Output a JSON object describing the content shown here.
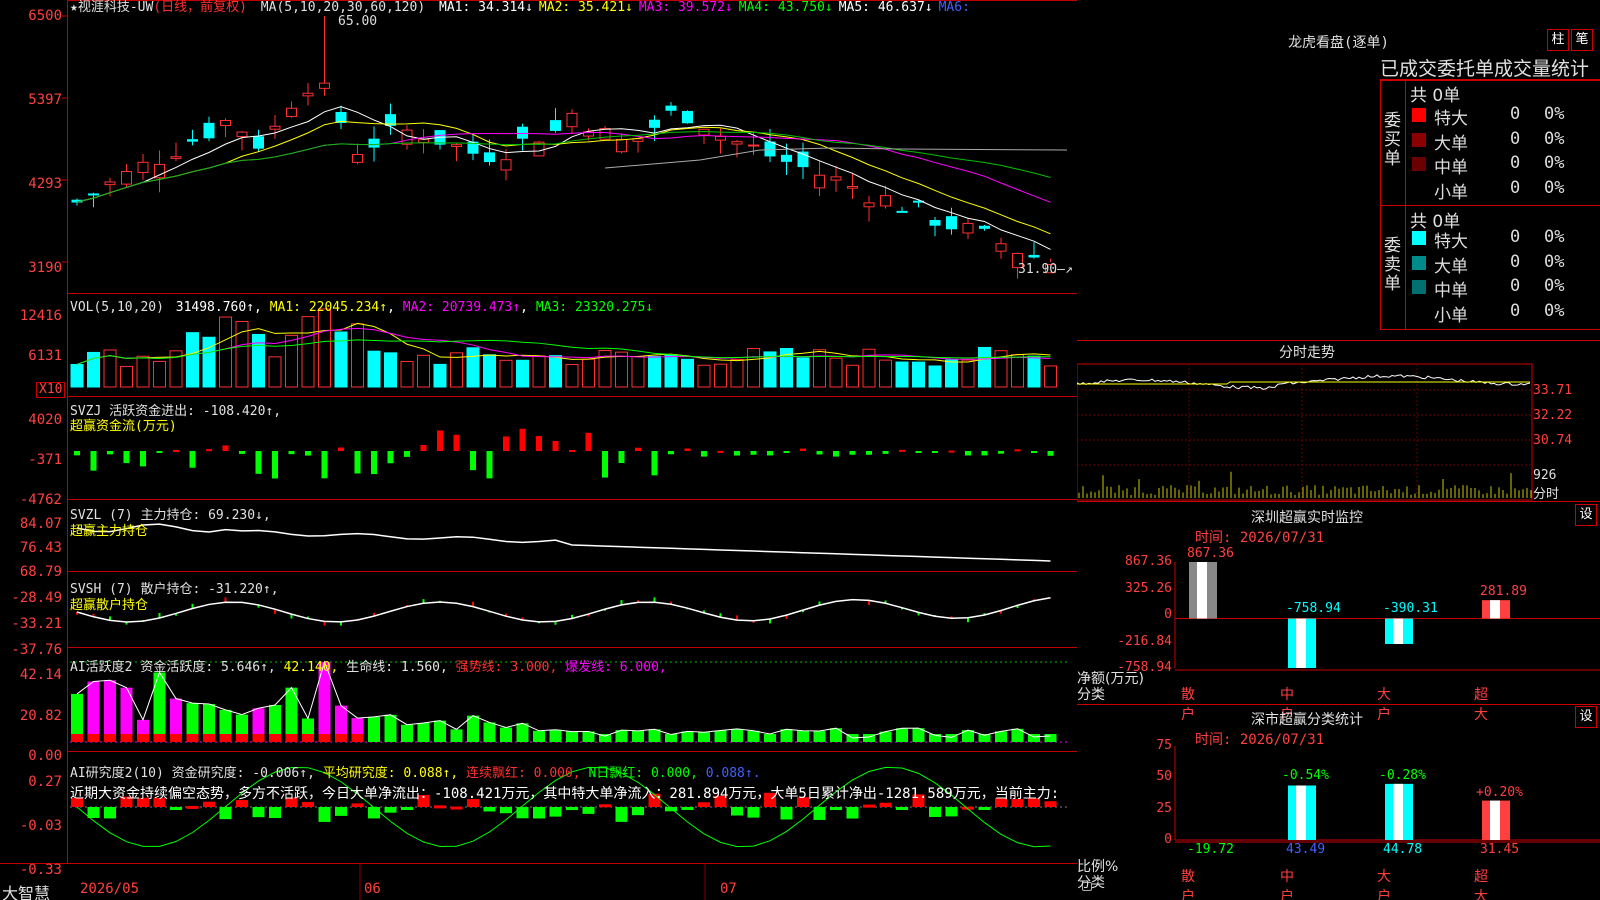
{
  "chart_title": {
    "stock_name": "★视涯科技-UW",
    "period_tag": "(日线，前复权)",
    "ma_spec": "MA(5,10,20,30,60,120)",
    "ma_values": [
      {
        "label": "MA1:",
        "value": "34.314↓",
        "color": "#ffffff"
      },
      {
        "label": "MA2:",
        "value": "35.421↓",
        "color": "#ffff00"
      },
      {
        "label": "MA3:",
        "value": "39.572↓",
        "color": "#ff00ff"
      },
      {
        "label": "MA4:",
        "value": "43.750↓",
        "color": "#00ff00"
      },
      {
        "label": "MA5:",
        "value": "46.637↓",
        "color": "#ffffff"
      },
      {
        "label": "MA6:",
        "value": "",
        "color": "#4060ff"
      }
    ],
    "high_label": "65.00",
    "low_label": "31.90"
  },
  "main_y_labels": [
    "6500",
    "5397",
    "4293",
    "3190"
  ],
  "vol": {
    "header": "VOL(5,10,20)",
    "value": "31498.760↑",
    "ma1": "MA1: 22045.234↑",
    "ma2": "MA2: 20739.473↑",
    "ma3": "MA3: 23320.275↓",
    "y_labels": [
      "12416",
      "6131"
    ],
    "unit_tag": "X10"
  },
  "svzj": {
    "header": "SVZJ  活跃资金进出: -108.420↑,",
    "sub": "超赢资金流(万元)",
    "y_labels": [
      "4020",
      "-371",
      "-4762"
    ]
  },
  "svzl": {
    "header": "SVZL (7) 主力持仓: 69.230↓,",
    "sub": "超赢主力持仓",
    "y_labels": [
      "84.07",
      "76.43",
      "68.79"
    ]
  },
  "svsh": {
    "header": "SVSH (7) 散户持仓: -31.220↑,",
    "sub": "超赢散户持仓",
    "y_labels": [
      "-28.49",
      "-33.21",
      "-37.76"
    ]
  },
  "ai_active": {
    "title": "AI活跃度2",
    "part1": "资金活跃度: 5.646↑,",
    "part2": "42.140,",
    "part3": "生命线: 1.560,",
    "part4": "强势线: 3.000,",
    "part5": "爆发线: 6.000,",
    "y_labels": [
      "42.14",
      "20.82",
      "0.00"
    ]
  },
  "ai_research": {
    "title": "AI研究度2(10)",
    "part1": "资金研究度: -0.006↑,",
    "part2": "平均研究度: 0.088↑,",
    "part3": "连续飘红: 0.000,",
    "part4": "N日飘红: 0.000,",
    "part5": "0.088↑.",
    "commentary": "近期大资金持续偏空态势，多方不活跃，今日大单净流出：-108.421万元，其中特大单净流入：281.894万元，大单5日累计净出-1281.589万元，当前主力:",
    "y_labels": [
      "0.27",
      "-0.03",
      "-0.33"
    ]
  },
  "x_axis": {
    "brand": "大智慧",
    "labels": [
      "2026/05",
      "06",
      "07"
    ]
  },
  "longhu": {
    "title": "龙虎看盘(逐单)",
    "btn_col": "柱",
    "btn_bi": "笔",
    "tabs": [
      "已成交",
      "委托单",
      "成交量统计"
    ],
    "buy_total": "共 0单",
    "sell_total": "共 0单",
    "buy_side_label": "委买单",
    "sell_side_label": "委卖单",
    "buy_rows": [
      {
        "name": "特大",
        "count": "0",
        "pct": "0%",
        "color": "#ff0000"
      },
      {
        "name": "大单",
        "count": "0",
        "pct": "0%",
        "color": "#8b0000"
      },
      {
        "name": "中单",
        "count": "0",
        "pct": "0%",
        "color": "#6b0000"
      },
      {
        "name": "小单",
        "count": "0",
        "pct": "0%",
        "color": ""
      }
    ],
    "sell_rows": [
      {
        "name": "特大",
        "count": "0",
        "pct": "0%",
        "color": "#00ffff"
      },
      {
        "name": "大单",
        "count": "0",
        "pct": "0%",
        "color": "#008b8b"
      },
      {
        "name": "中单",
        "count": "0",
        "pct": "0%",
        "color": "#007070"
      },
      {
        "name": "小单",
        "count": "0",
        "pct": "0%",
        "color": ""
      }
    ]
  },
  "intraday": {
    "title": "分时走势",
    "price_labels": [
      "33.71",
      "32.22",
      "30.74"
    ],
    "vol_label": "926",
    "vol_unit": "分时"
  },
  "realtime_monitor": {
    "title": "深圳超赢实时监控",
    "btn": "设",
    "time": "时间: 2026/07/31",
    "y_labels": [
      "867.36",
      "325.26",
      "0",
      "-216.84",
      "-758.94"
    ],
    "axis_caption_1": "净额(万元)",
    "axis_caption_2": "分类",
    "categories": [
      "散户",
      "中户",
      "大户",
      "超大"
    ],
    "values": [
      867.36,
      -758.94,
      -390.31,
      281.89
    ],
    "value_labels": [
      "867.36",
      "-758.94",
      "-390.31",
      "281.89"
    ]
  },
  "category_stats": {
    "title": "深市超赢分类统计",
    "btn": "设",
    "time": "时间: 2026/07/31",
    "y_labels": [
      "75",
      "50",
      "25",
      "0"
    ],
    "axis_caption_1": "比例%",
    "axis_caption_2": "分类",
    "categories": [
      "散户",
      "中户",
      "大户",
      "超大"
    ],
    "values": [
      -19.72,
      43.49,
      44.78,
      31.45
    ],
    "value_labels": [
      "-19.72",
      "43.49",
      "44.78",
      "31.45"
    ],
    "change_labels": [
      "",
      "-0.54%",
      "-0.28%",
      "+0.20%"
    ]
  },
  "chart_data": [
    {
      "type": "bar",
      "title": "深圳超赢实时监控",
      "categories": [
        "散户",
        "中户",
        "大户",
        "超大"
      ],
      "values": [
        867.36,
        -758.94,
        -390.31,
        281.89
      ],
      "ylabel": "净额(万元)",
      "ylim": [
        -758.94,
        867.36
      ]
    },
    {
      "type": "bar",
      "title": "深市超赢分类统计",
      "categories": [
        "散户",
        "中户",
        "大户",
        "超大"
      ],
      "values": [
        -19.72,
        43.49,
        44.78,
        31.45
      ],
      "ylabel": "比例%",
      "ylim": [
        0,
        75
      ]
    }
  ],
  "colors": {
    "up": "#ff3030",
    "down": "#00ffff",
    "grid": "#8b0000",
    "border": "#c00000",
    "text_red": "#ff4040"
  }
}
